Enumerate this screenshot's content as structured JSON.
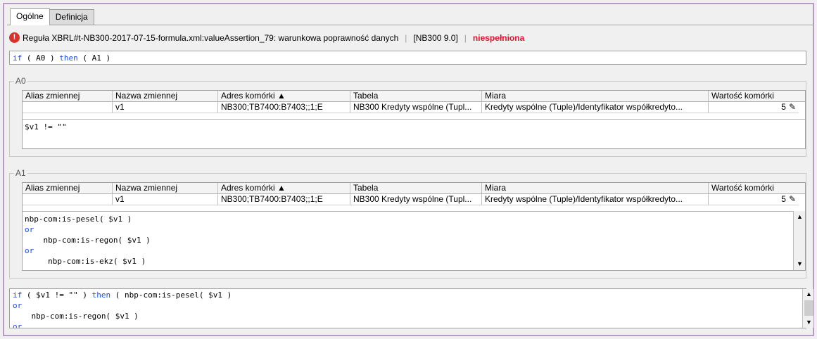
{
  "tabs": [
    {
      "label": "Ogólne",
      "active": true
    },
    {
      "label": "Definicja",
      "active": false
    }
  ],
  "rule": {
    "icon": "error-icon",
    "text": "Reguła XBRL#t-NB300-2017-07-15-formula.xml:valueAssertion_79: warunkowa poprawność danych",
    "version": "[NB300 9.0]",
    "status": "niespełniona",
    "status_color": "#e0122f"
  },
  "formula": {
    "if": "if",
    "cond": " ( A0 ) ",
    "then": "then",
    "rest": " ( A1 )"
  },
  "columns": [
    "Alias zmiennej",
    "Nazwa zmiennej",
    "Adres komórki ▲",
    "Tabela",
    "Miara",
    "Wartość komórki"
  ],
  "groups": {
    "a0": {
      "label": "A0",
      "row": {
        "alias": "",
        "name": "v1",
        "address": "NB300;TB7400:B7403;;1;E",
        "table": "NB300 Kredyty wspólne (Tupl...",
        "measure": "Kredyty wspólne (Tuple)/Identyfikator współkredyto...",
        "value": "5"
      },
      "expression": "$v1 != \"\""
    },
    "a1": {
      "label": "A1",
      "row": {
        "alias": "",
        "name": "v1",
        "address": "NB300;TB7400:B7403;;1;E",
        "table": "NB300 Kredyty wspólne (Tupl...",
        "measure": "Kredyty wspólne (Tuple)/Identyfikator współkredyto...",
        "value": "5"
      },
      "expr_lines": [
        {
          "text": "nbp-com:is-pesel( $v1 )",
          "kw": false
        },
        {
          "text": "or",
          "kw": true
        },
        {
          "text": "    nbp-com:is-regon( $v1 )",
          "kw": false
        },
        {
          "text": "or",
          "kw": true
        },
        {
          "text": "     nbp-com:is-ekz( $v1 )",
          "kw": false
        }
      ]
    }
  },
  "bottom": {
    "lines": [
      [
        {
          "t": "if",
          "kw": true
        },
        {
          "t": " ( $v1 != \"\" ) ",
          "kw": false
        },
        {
          "t": "then",
          "kw": true
        },
        {
          "t": " ( nbp-com:is-pesel( $v1 )",
          "kw": false
        }
      ],
      [
        {
          "t": "or",
          "kw": true
        }
      ],
      [
        {
          "t": "    nbp-com:is-regon( $v1 )",
          "kw": false
        }
      ],
      [
        {
          "t": "or",
          "kw": true
        }
      ]
    ]
  },
  "icons": {
    "pencil": "pencil-icon",
    "scroll_up": "scroll-up-icon",
    "scroll_down": "scroll-down-icon"
  }
}
